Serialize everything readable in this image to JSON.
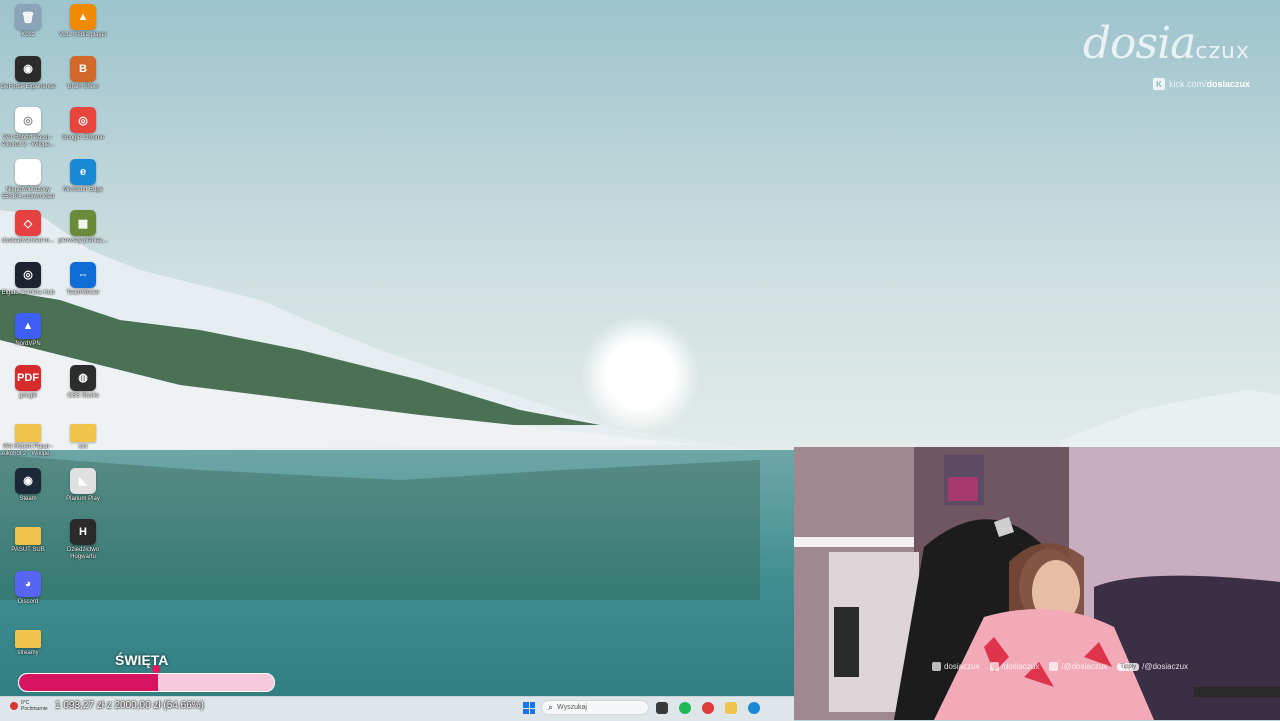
{
  "desktop": {
    "icons": [
      {
        "label": "Kosz",
        "glyph": "trash-icon",
        "color": "#8aa3b8",
        "sym": "🗑"
      },
      {
        "label": "VLC media player",
        "glyph": "vlc-icon",
        "color": "#f08a00",
        "sym": "▲"
      },
      {
        "label": "GeForce Experience",
        "glyph": "nvidia-icon",
        "color": "#2b2b2b",
        "sym": "◉"
      },
      {
        "label": "Brain Show",
        "glyph": "brain-show-icon",
        "color": "#d2692a",
        "sym": "B"
      },
      {
        "label": "PAI Robert Pasut - Alkohol 2 - Wikipe...",
        "glyph": "chrome-shortcut-icon",
        "color": "#ffffff",
        "sym": "◎"
      },
      {
        "label": "Google Chrome",
        "glyph": "chrome-icon",
        "color": "#e8453c",
        "sym": "◎"
      },
      {
        "label": "Niepotwierdzony 553104.crdownload",
        "glyph": "file-icon",
        "color": "#ffffff",
        "sym": ""
      },
      {
        "label": "Microsoft Edge",
        "glyph": "edge-icon",
        "color": "#1b8ad6",
        "sym": "e"
      },
      {
        "label": "dosiaadvanced-m...",
        "glyph": "app-icon",
        "color": "#e54141",
        "sym": "◇"
      },
      {
        "label": "pierwszy-pieniez...",
        "glyph": "image-icon",
        "color": "#6a8b3a",
        "sym": "▦"
      },
      {
        "label": "Elgato Camera Hub",
        "glyph": "elgato-icon",
        "color": "#1e2230",
        "sym": "◎"
      },
      {
        "label": "TeamViewer",
        "glyph": "teamviewer-icon",
        "color": "#0e6ed6",
        "sym": "⇔"
      },
      {
        "label": "NordVPN",
        "glyph": "nordvpn-icon",
        "color": "#3e5ff5",
        "sym": "▲"
      },
      {
        "label": "",
        "glyph": "empty",
        "color": "transparent",
        "sym": ""
      },
      {
        "label": "google",
        "glyph": "pdf-icon",
        "color": "#d62b2b",
        "sym": "PDF"
      },
      {
        "label": "OBS Studio",
        "glyph": "obs-icon",
        "color": "#2d2d2d",
        "sym": "◍"
      },
      {
        "label": "PAI Robert Pasut - Alkohol 2 - Wikipe...",
        "glyph": "folder-icon",
        "color": "#f0c44a",
        "sym": ""
      },
      {
        "label": "xxx",
        "glyph": "folder-icon",
        "color": "#f0c44a",
        "sym": ""
      },
      {
        "label": "Steam",
        "glyph": "steam-icon",
        "color": "#1b2838",
        "sym": "◉"
      },
      {
        "label": "Plarium Play",
        "glyph": "plarium-icon",
        "color": "#e0e0e0",
        "sym": "◣"
      },
      {
        "label": "PASUT SUB",
        "glyph": "folder-icon",
        "color": "#f0c44a",
        "sym": ""
      },
      {
        "label": "Dziedzictwo Hogwartu",
        "glyph": "hogwarts-icon",
        "color": "#2a2a2a",
        "sym": "H"
      },
      {
        "label": "Discord",
        "glyph": "discord-icon",
        "color": "#5865f2",
        "sym": "◕"
      },
      {
        "label": "",
        "glyph": "empty",
        "color": "transparent",
        "sym": ""
      },
      {
        "label": "streamy",
        "glyph": "folder-icon",
        "color": "#f0c44a",
        "sym": ""
      }
    ]
  },
  "watermark": {
    "logo": "dosia",
    "logo_small": "czux",
    "kick_prefix": "kick.com/",
    "kick_handle": "dosiaczux"
  },
  "webcam": {
    "socials": [
      {
        "icon": "instagram-icon",
        "text": "dosiaczux"
      },
      {
        "icon": "tiktok-icon",
        "text": "/dosiaczux"
      },
      {
        "icon": "youtube-icon",
        "text": "/@dosiaczux"
      },
      {
        "icon": "tipply-icon",
        "text": "/@dosiaczux",
        "badge": "Tipply"
      }
    ]
  },
  "goal": {
    "title": "ŚWIĘTA",
    "amount_text": "1 093,27 zł z 2000,00 zł (54.66%)",
    "progress": 0.5466,
    "fill_color": "#d6145f",
    "track_color": "#f6c9dc"
  },
  "taskbar": {
    "weather_temp": "0°C",
    "weather_desc": "Pochmurnie",
    "search_placeholder": "Wyszukaj",
    "apps": [
      {
        "name": "file-manager-icon",
        "color": "#3a3a3a"
      },
      {
        "name": "spotify-icon",
        "color": "#1db954"
      },
      {
        "name": "app-red-icon",
        "color": "#e03a3a"
      },
      {
        "name": "folder-taskbar-icon",
        "color": "#f0c44a"
      },
      {
        "name": "edge-taskbar-icon",
        "color": "#1b8ad6"
      }
    ]
  }
}
